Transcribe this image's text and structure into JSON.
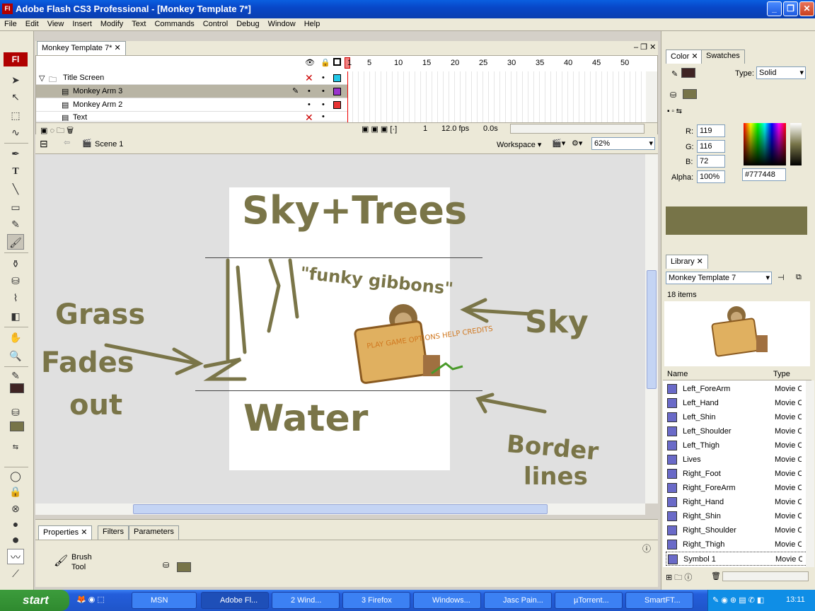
{
  "window": {
    "title": "Adobe Flash CS3 Professional - [Monkey Template 7*]",
    "app_badge": "Fl"
  },
  "menu": [
    "File",
    "Edit",
    "View",
    "Insert",
    "Modify",
    "Text",
    "Commands",
    "Control",
    "Debug",
    "Window",
    "Help"
  ],
  "document": {
    "tab": "Monkey Template 7*"
  },
  "timeline": {
    "ruler": [
      "1",
      "5",
      "10",
      "15",
      "20",
      "25",
      "30",
      "35",
      "40",
      "45",
      "50"
    ],
    "layers": [
      {
        "name": "Title Screen",
        "color": "#22c8e8",
        "folder": true
      },
      {
        "name": "Monkey Arm 3",
        "color": "#9933cc",
        "selected": true
      },
      {
        "name": "Monkey Arm 2",
        "color": "#e83333"
      },
      {
        "name": "Text",
        "color": "#888888"
      }
    ],
    "current_frame": "1",
    "fps": "12.0 fps",
    "time": "0.0s"
  },
  "editbar": {
    "scene": "Scene 1",
    "workspace": "Workspace",
    "zoom": "62%"
  },
  "stage_text": {
    "sky_trees": "Sky+Trees",
    "funky": "\"funky gibbons\"",
    "water": "Water",
    "grass": "Grass",
    "fades": "Fades",
    "out": "out",
    "sky": "Sky",
    "border": "Border",
    "lines": "lines",
    "sign_text": "PLAY GAME OPTIONS HELP CREDITS"
  },
  "properties": {
    "tabs": [
      "Properties",
      "Filters",
      "Parameters"
    ],
    "tool_line1": "Brush",
    "tool_line2": "Tool",
    "fill_color": "#777448"
  },
  "color_panel": {
    "tabs": [
      "Color",
      "Swatches"
    ],
    "type_label": "Type:",
    "type_value": "Solid",
    "r_label": "R:",
    "r": "119",
    "g_label": "G:",
    "g": "116",
    "b_label": "B:",
    "b": "72",
    "alpha_label": "Alpha:",
    "alpha": "100%",
    "hex": "#777448",
    "stroke_color": "#3f2424",
    "fill_color": "#777448"
  },
  "library": {
    "tab": "Library",
    "document": "Monkey Template 7",
    "count": "18 items",
    "col_name": "Name",
    "col_type": "Type",
    "items": [
      {
        "name": "Left_ForeArm",
        "type": "Movie Clip"
      },
      {
        "name": "Left_Hand",
        "type": "Movie Clip"
      },
      {
        "name": "Left_Shin",
        "type": "Movie Clip"
      },
      {
        "name": "Left_Shoulder",
        "type": "Movie Clip"
      },
      {
        "name": "Left_Thigh",
        "type": "Movie Clip"
      },
      {
        "name": "Lives",
        "type": "Movie Clip"
      },
      {
        "name": "Right_Foot",
        "type": "Movie Clip"
      },
      {
        "name": "Right_ForeArm",
        "type": "Movie Clip"
      },
      {
        "name": "Right_Hand",
        "type": "Movie Clip"
      },
      {
        "name": "Right_Shin",
        "type": "Movie Clip"
      },
      {
        "name": "Right_Shoulder",
        "type": "Movie Clip"
      },
      {
        "name": "Right_Thigh",
        "type": "Movie Clip"
      },
      {
        "name": "Symbol 1",
        "type": "Movie Clip"
      }
    ]
  },
  "taskbar": {
    "start": "start",
    "tasks": [
      "MSN",
      "Adobe Fl...",
      "2 Wind...",
      "3 Firefox",
      "Windows...",
      "Jasc Pain...",
      "µTorrent...",
      "SmartFT..."
    ],
    "clock": "13:11"
  }
}
